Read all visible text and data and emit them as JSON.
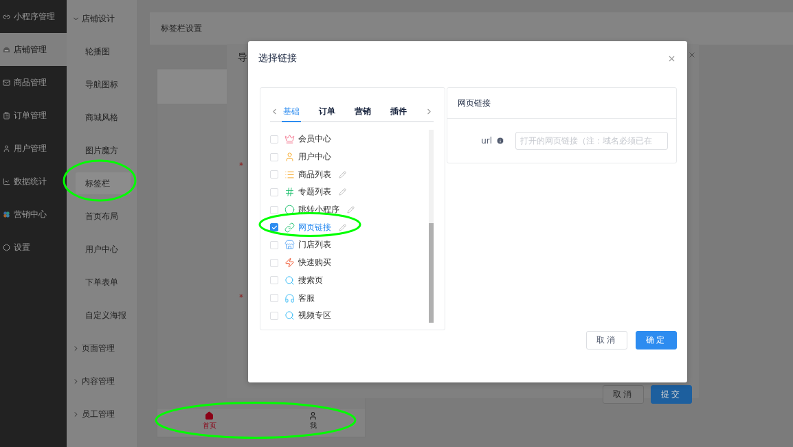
{
  "sidebar": {
    "items": [
      {
        "label": "小程序管理",
        "selected": false
      },
      {
        "label": "店铺管理",
        "selected": true
      },
      {
        "label": "商品管理",
        "selected": false
      },
      {
        "label": "订单管理",
        "selected": false
      },
      {
        "label": "用户管理",
        "selected": false
      },
      {
        "label": "数据统计",
        "selected": false
      },
      {
        "label": "营销中心",
        "selected": false
      },
      {
        "label": "设置",
        "selected": false
      }
    ]
  },
  "submenu": {
    "groups": [
      {
        "label": "店铺设计",
        "expanded": true,
        "children": [
          {
            "label": "轮播图",
            "selected": false
          },
          {
            "label": "导航图标",
            "selected": false
          },
          {
            "label": "商城风格",
            "selected": false
          },
          {
            "label": "图片魔方",
            "selected": false
          },
          {
            "label": "标签栏",
            "selected": true
          },
          {
            "label": "首页布局",
            "selected": false
          },
          {
            "label": "用户中心",
            "selected": false
          },
          {
            "label": "下单表单",
            "selected": false
          },
          {
            "label": "自定义海报",
            "selected": false
          }
        ]
      },
      {
        "label": "页面管理",
        "expanded": false
      },
      {
        "label": "内容管理",
        "expanded": false
      },
      {
        "label": "员工管理",
        "expanded": false
      }
    ]
  },
  "content": {
    "title": "标签栏设置"
  },
  "preview": {
    "tabbar": [
      {
        "label": "首页",
        "selected": true
      },
      {
        "label": "我",
        "selected": false
      }
    ]
  },
  "back_dialog": {
    "title": "导",
    "required_marks": [
      "*",
      "*"
    ],
    "buttons": [
      {
        "label": "取消",
        "kind": "default"
      },
      {
        "label": "提交",
        "kind": "primary"
      }
    ]
  },
  "modal": {
    "title": "选择链接",
    "tabs": [
      {
        "label": "基础",
        "selected": true
      },
      {
        "label": "订单",
        "selected": false
      },
      {
        "label": "营销",
        "selected": false
      },
      {
        "label": "插件",
        "selected": false
      }
    ],
    "links": [
      {
        "label": "会员中心",
        "checked": false,
        "editable": false
      },
      {
        "label": "用户中心",
        "checked": false,
        "editable": false
      },
      {
        "label": "商品列表",
        "checked": false,
        "editable": true
      },
      {
        "label": "专题列表",
        "checked": false,
        "editable": true
      },
      {
        "label": "跳转小程序",
        "checked": false,
        "editable": true
      },
      {
        "label": "网页链接",
        "checked": true,
        "editable": true
      },
      {
        "label": "门店列表",
        "checked": false,
        "editable": false
      },
      {
        "label": "快速购买",
        "checked": false,
        "editable": false
      },
      {
        "label": "搜索页",
        "checked": false,
        "editable": false
      },
      {
        "label": "客服",
        "checked": false,
        "editable": false
      },
      {
        "label": "视频专区",
        "checked": false,
        "editable": false
      }
    ],
    "detail": {
      "title": "网页链接",
      "field": {
        "label": "url",
        "placeholder": "打开的网页链接（注：域名必须已在"
      }
    },
    "buttons": [
      {
        "label": "取消",
        "kind": "default"
      },
      {
        "label": "确定",
        "kind": "primary"
      }
    ]
  }
}
